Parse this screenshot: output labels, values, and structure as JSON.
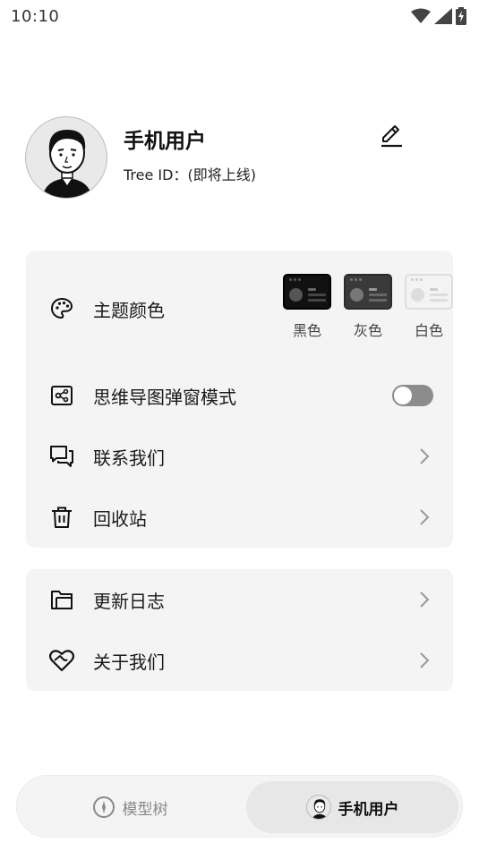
{
  "status_bar": {
    "time": "10:10",
    "icons": [
      "wifi-icon",
      "signal-icon",
      "battery-charging-icon"
    ]
  },
  "profile": {
    "name": "手机用户",
    "tree_id": "Tree ID：(即将上线)",
    "avatar_icon": "cartoon-avatar-icon",
    "edit_icon": "pencil-icon"
  },
  "settings": {
    "theme": {
      "label": "主题颜色",
      "icon": "palette-icon",
      "options": [
        {
          "label": "黑色",
          "swatch": "dark"
        },
        {
          "label": "灰色",
          "swatch": "gray"
        },
        {
          "label": "白色",
          "swatch": "white"
        }
      ]
    },
    "mindmap_popup": {
      "label": "思维导图弹窗模式",
      "icon": "mindmap-icon",
      "enabled": false
    },
    "contact": {
      "label": "联系我们",
      "icon": "chat-icon"
    },
    "recycle_bin": {
      "label": "回收站",
      "icon": "trash-icon"
    }
  },
  "about": {
    "changelog": {
      "label": "更新日志",
      "icon": "folder-icon"
    },
    "about_us": {
      "label": "关于我们",
      "icon": "heart-handshake-icon"
    }
  },
  "tab_bar": {
    "tabs": [
      {
        "label": "模型树",
        "icon": "compass-icon",
        "active": false
      },
      {
        "label": "手机用户",
        "icon": "avatar-icon",
        "active": true
      }
    ]
  },
  "colors": {
    "background": "#ffffff",
    "card": "#f4f4f4",
    "text": "#1a1a1a",
    "toggle_off": "#8c8c8c",
    "active_tab": "#e7e7e7"
  }
}
